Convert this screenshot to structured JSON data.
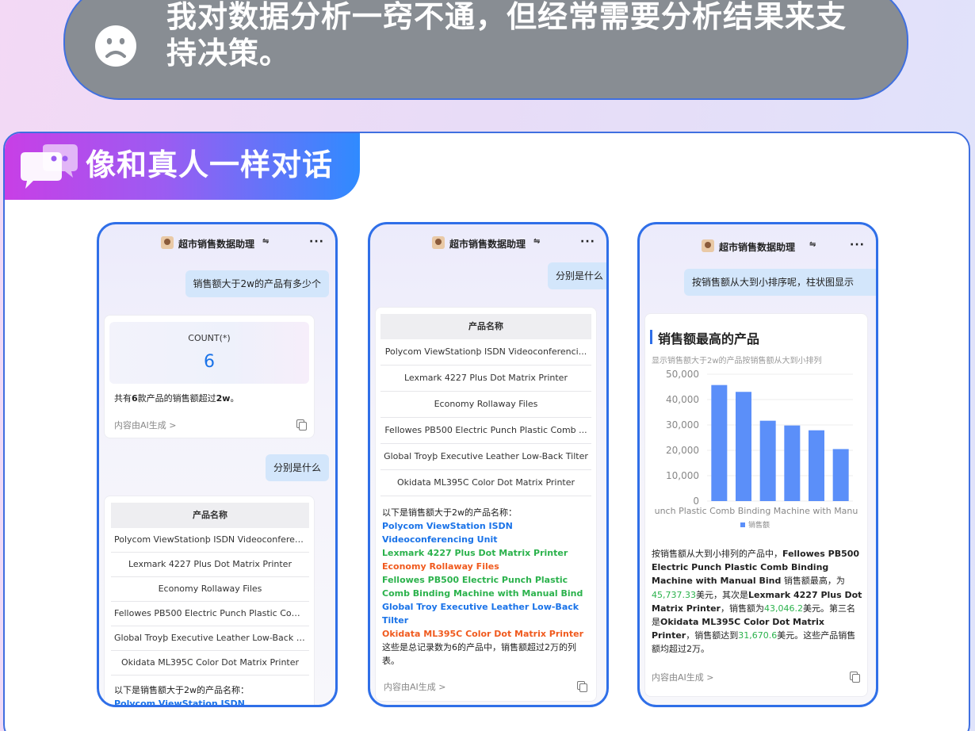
{
  "header": {
    "text": "我对数据分析一窍不通，但经常需要分析结果来支持决策。"
  },
  "banner": {
    "title": "像和真人一样对话"
  },
  "phones": [
    {
      "app_name": "超市销售数据助理",
      "user_q1": "销售额大于2w的产品有多少个",
      "count_label": "COUNT(*)",
      "count_value": "6",
      "summary_pre": "共有",
      "summary_num": "6",
      "summary_mid": "款产品的销售额超过",
      "summary_num2": "2w",
      "summary_end": "。",
      "ai_note": "内容由AI生成 >",
      "user_q2": "分别是什么",
      "table_header": "产品名称",
      "rows": [
        "Polycom ViewStationþ ISDN Videoconferenci...",
        "Lexmark 4227 Plus Dot Matrix Printer",
        "Economy Rollaway Files",
        "Fellowes PB500 Electric Punch Plastic Comb ...",
        "Global Troyþ Executive Leather Low-Back Tilter",
        "Okidata ML395C Color Dot Matrix Printer"
      ],
      "tail_text": "以下是销售额大于2w的产品名称：",
      "tail_link": "Polycom ViewStation ISDN"
    },
    {
      "app_name": "超市销售数据助理",
      "user_q": "分别是什么",
      "table_header": "产品名称",
      "rows": [
        "Polycom ViewStationþ ISDN Videoconferenci...",
        "Lexmark 4227 Plus Dot Matrix Printer",
        "Economy Rollaway Files",
        "Fellowes PB500 Electric Punch Plastic Comb ...",
        "Global Troyþ Executive Leather Low-Back Tilter",
        "Okidata ML395C Color Dot Matrix Printer"
      ],
      "answer_intro": "以下是销售额大于2w的产品名称：",
      "answer_items": [
        {
          "text": "Polycom ViewStation ISDN Videoconferencing Unit",
          "color": "blue"
        },
        {
          "text": "Lexmark 4227 Plus Dot Matrix Printer",
          "color": "green"
        },
        {
          "text": "Economy Rollaway Files",
          "color": "orange"
        },
        {
          "text": "Fellowes PB500 Electric Punch Plastic Comb Binding Machine with Manual Bind",
          "color": "green"
        },
        {
          "text": "Global Troy Executive Leather Low-Back Tilter",
          "color": "blue"
        },
        {
          "text": "Okidata ML395C Color Dot Matrix Printer",
          "color": "orange"
        }
      ],
      "answer_outro": "这些是总记录数为6的产品中，销售额超过2万的列表。",
      "ai_note": "内容由AI生成 >"
    },
    {
      "app_name": "超市销售数据助理",
      "user_q": "按销售额从大到小排序呢，柱状图显示",
      "chart_title": "销售额最高的产品",
      "chart_subtitle": "显示销售额大于2w的产品按销售额从大到小排列",
      "x_label_visible": "unch Plastic Comb Binding Machine with Manu",
      "legend": "销售额",
      "summary": [
        {
          "t": "按销售额从大到小排列的产品中，",
          "s": ""
        },
        {
          "t": "Fellowes PB500 Electric Punch Plastic Comb Binding Machine with Manual Bind",
          "s": "b"
        },
        {
          "t": " 销售额最高，为",
          "s": ""
        },
        {
          "t": "45,737.33",
          "s": "g"
        },
        {
          "t": "美元，其次是",
          "s": ""
        },
        {
          "t": "Lexmark 4227 Plus Dot Matrix Printer",
          "s": "b"
        },
        {
          "t": "，销售额为",
          "s": ""
        },
        {
          "t": "43,046.2",
          "s": "g"
        },
        {
          "t": "美元。第三名是",
          "s": ""
        },
        {
          "t": "Okidata ML395C Color Dot Matrix Printer",
          "s": "b"
        },
        {
          "t": "，销售额达到",
          "s": ""
        },
        {
          "t": "31,670.6",
          "s": "g"
        },
        {
          "t": "美元。这些产品销售额均超过2万。",
          "s": ""
        }
      ],
      "ai_note": "内容由AI生成 >"
    }
  ],
  "chart_data": {
    "type": "bar",
    "title": "销售额最高的产品",
    "subtitle": "显示销售额大于2w的产品按销售额从大到小排列",
    "series": [
      {
        "name": "销售额",
        "values": [
          45737.33,
          43046.2,
          31670.6,
          29800,
          27900,
          20500
        ]
      }
    ],
    "yticks": [
      "50,000",
      "40,000",
      "30,000",
      "20,000",
      "10,000",
      "0"
    ],
    "ylim": [
      0,
      50000
    ],
    "legend": "bottom",
    "bar_color": "#5b8ff9"
  }
}
